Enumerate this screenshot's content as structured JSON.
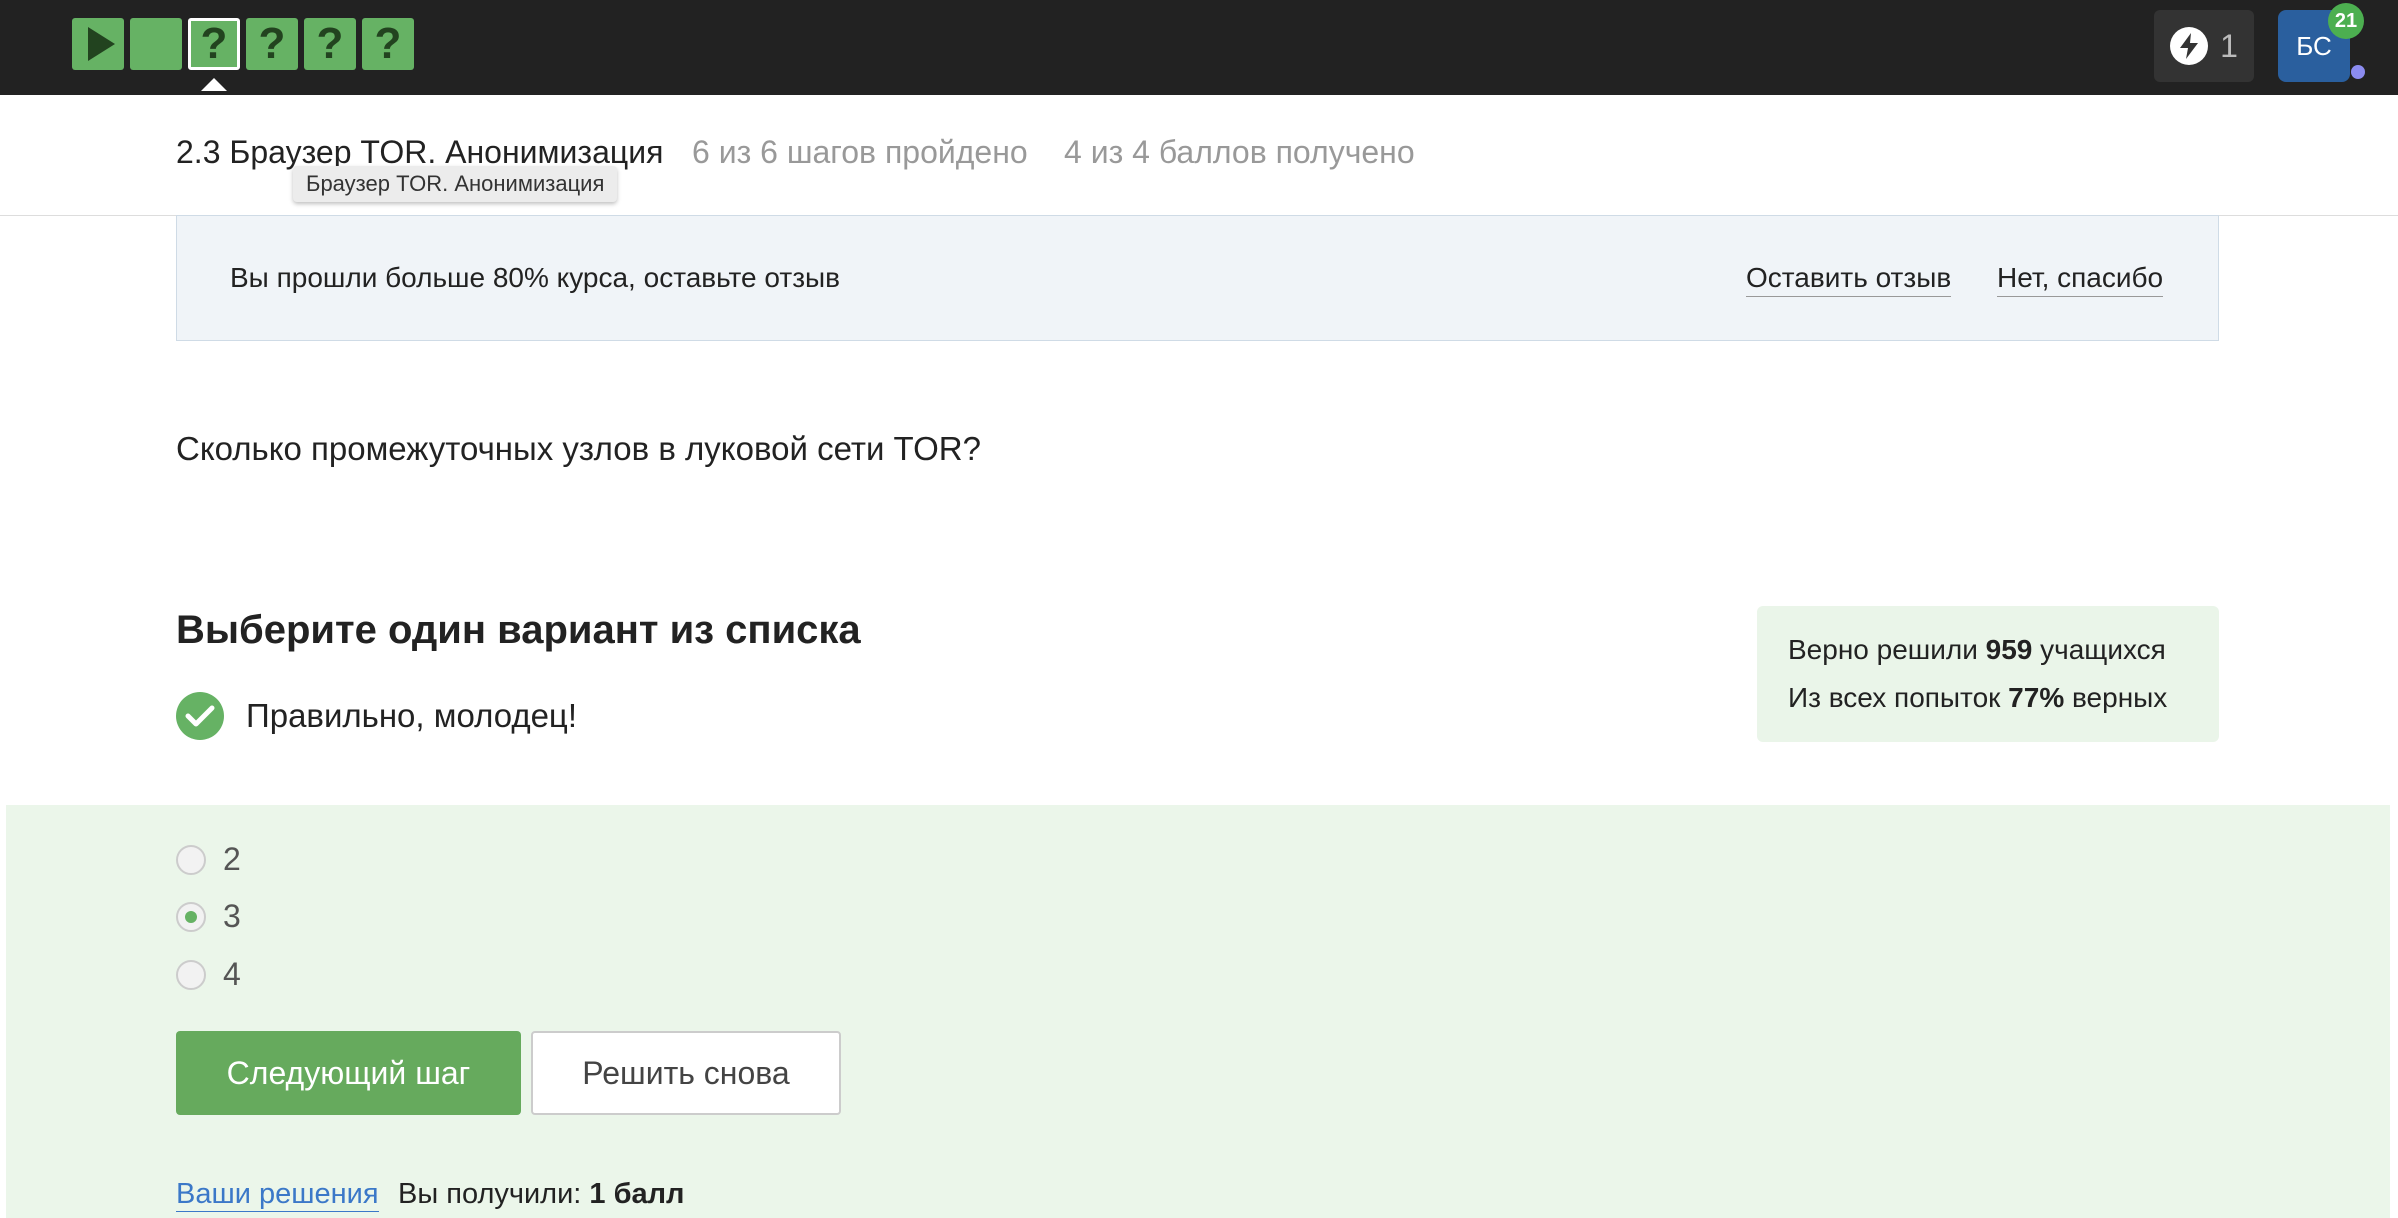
{
  "nav": {
    "steps": [
      {
        "type": "video",
        "icon": "play-icon"
      },
      {
        "type": "text",
        "icon": ""
      },
      {
        "type": "quiz",
        "icon": "question-icon",
        "label": "?"
      },
      {
        "type": "quiz",
        "icon": "question-icon",
        "label": "?"
      },
      {
        "type": "quiz",
        "icon": "question-icon",
        "label": "?"
      },
      {
        "type": "quiz",
        "icon": "question-icon",
        "label": "?"
      }
    ],
    "current_step": 3,
    "energy_count": "1",
    "avatar_initials": "БС",
    "notification_count": "21"
  },
  "lesson": {
    "title": "2.3 Браузер TOR. Анонимизация",
    "steps_progress": "6 из 6 шагов пройдено",
    "points": "4 из 4 баллов  получено",
    "tooltip": "Браузер TOR. Анонимизация"
  },
  "banner": {
    "text": "Вы прошли больше 80% курса, оставьте отзыв",
    "leave_review": "Оставить отзыв",
    "no_thanks": "Нет, спасибо"
  },
  "question": {
    "text": "Сколько промежуточных узлов в луковой сети TOR?",
    "prompt": "Выберите один вариант из списка",
    "result": "Правильно, молодец!"
  },
  "stats": {
    "solved_prefix": "Верно решили ",
    "solved_count": "959",
    "solved_suffix": " учащихся",
    "attempts_prefix": "Из всех попыток ",
    "attempts_percent": "77%",
    "attempts_suffix": " верных"
  },
  "options": [
    {
      "label": "2",
      "selected": false
    },
    {
      "label": "3",
      "selected": true
    },
    {
      "label": "4",
      "selected": false
    }
  ],
  "actions": {
    "next": "Следующий шаг",
    "retry": "Решить снова",
    "solutions": "Ваши решения",
    "score_prefix": "Вы получили: ",
    "score_value": "1 балл"
  },
  "colors": {
    "accent_green": "#66b264",
    "topbar": "#222222",
    "avatar": "#2a5f9e",
    "answer_bg": "#ebf6ea",
    "link_blue": "#3b78c8"
  }
}
